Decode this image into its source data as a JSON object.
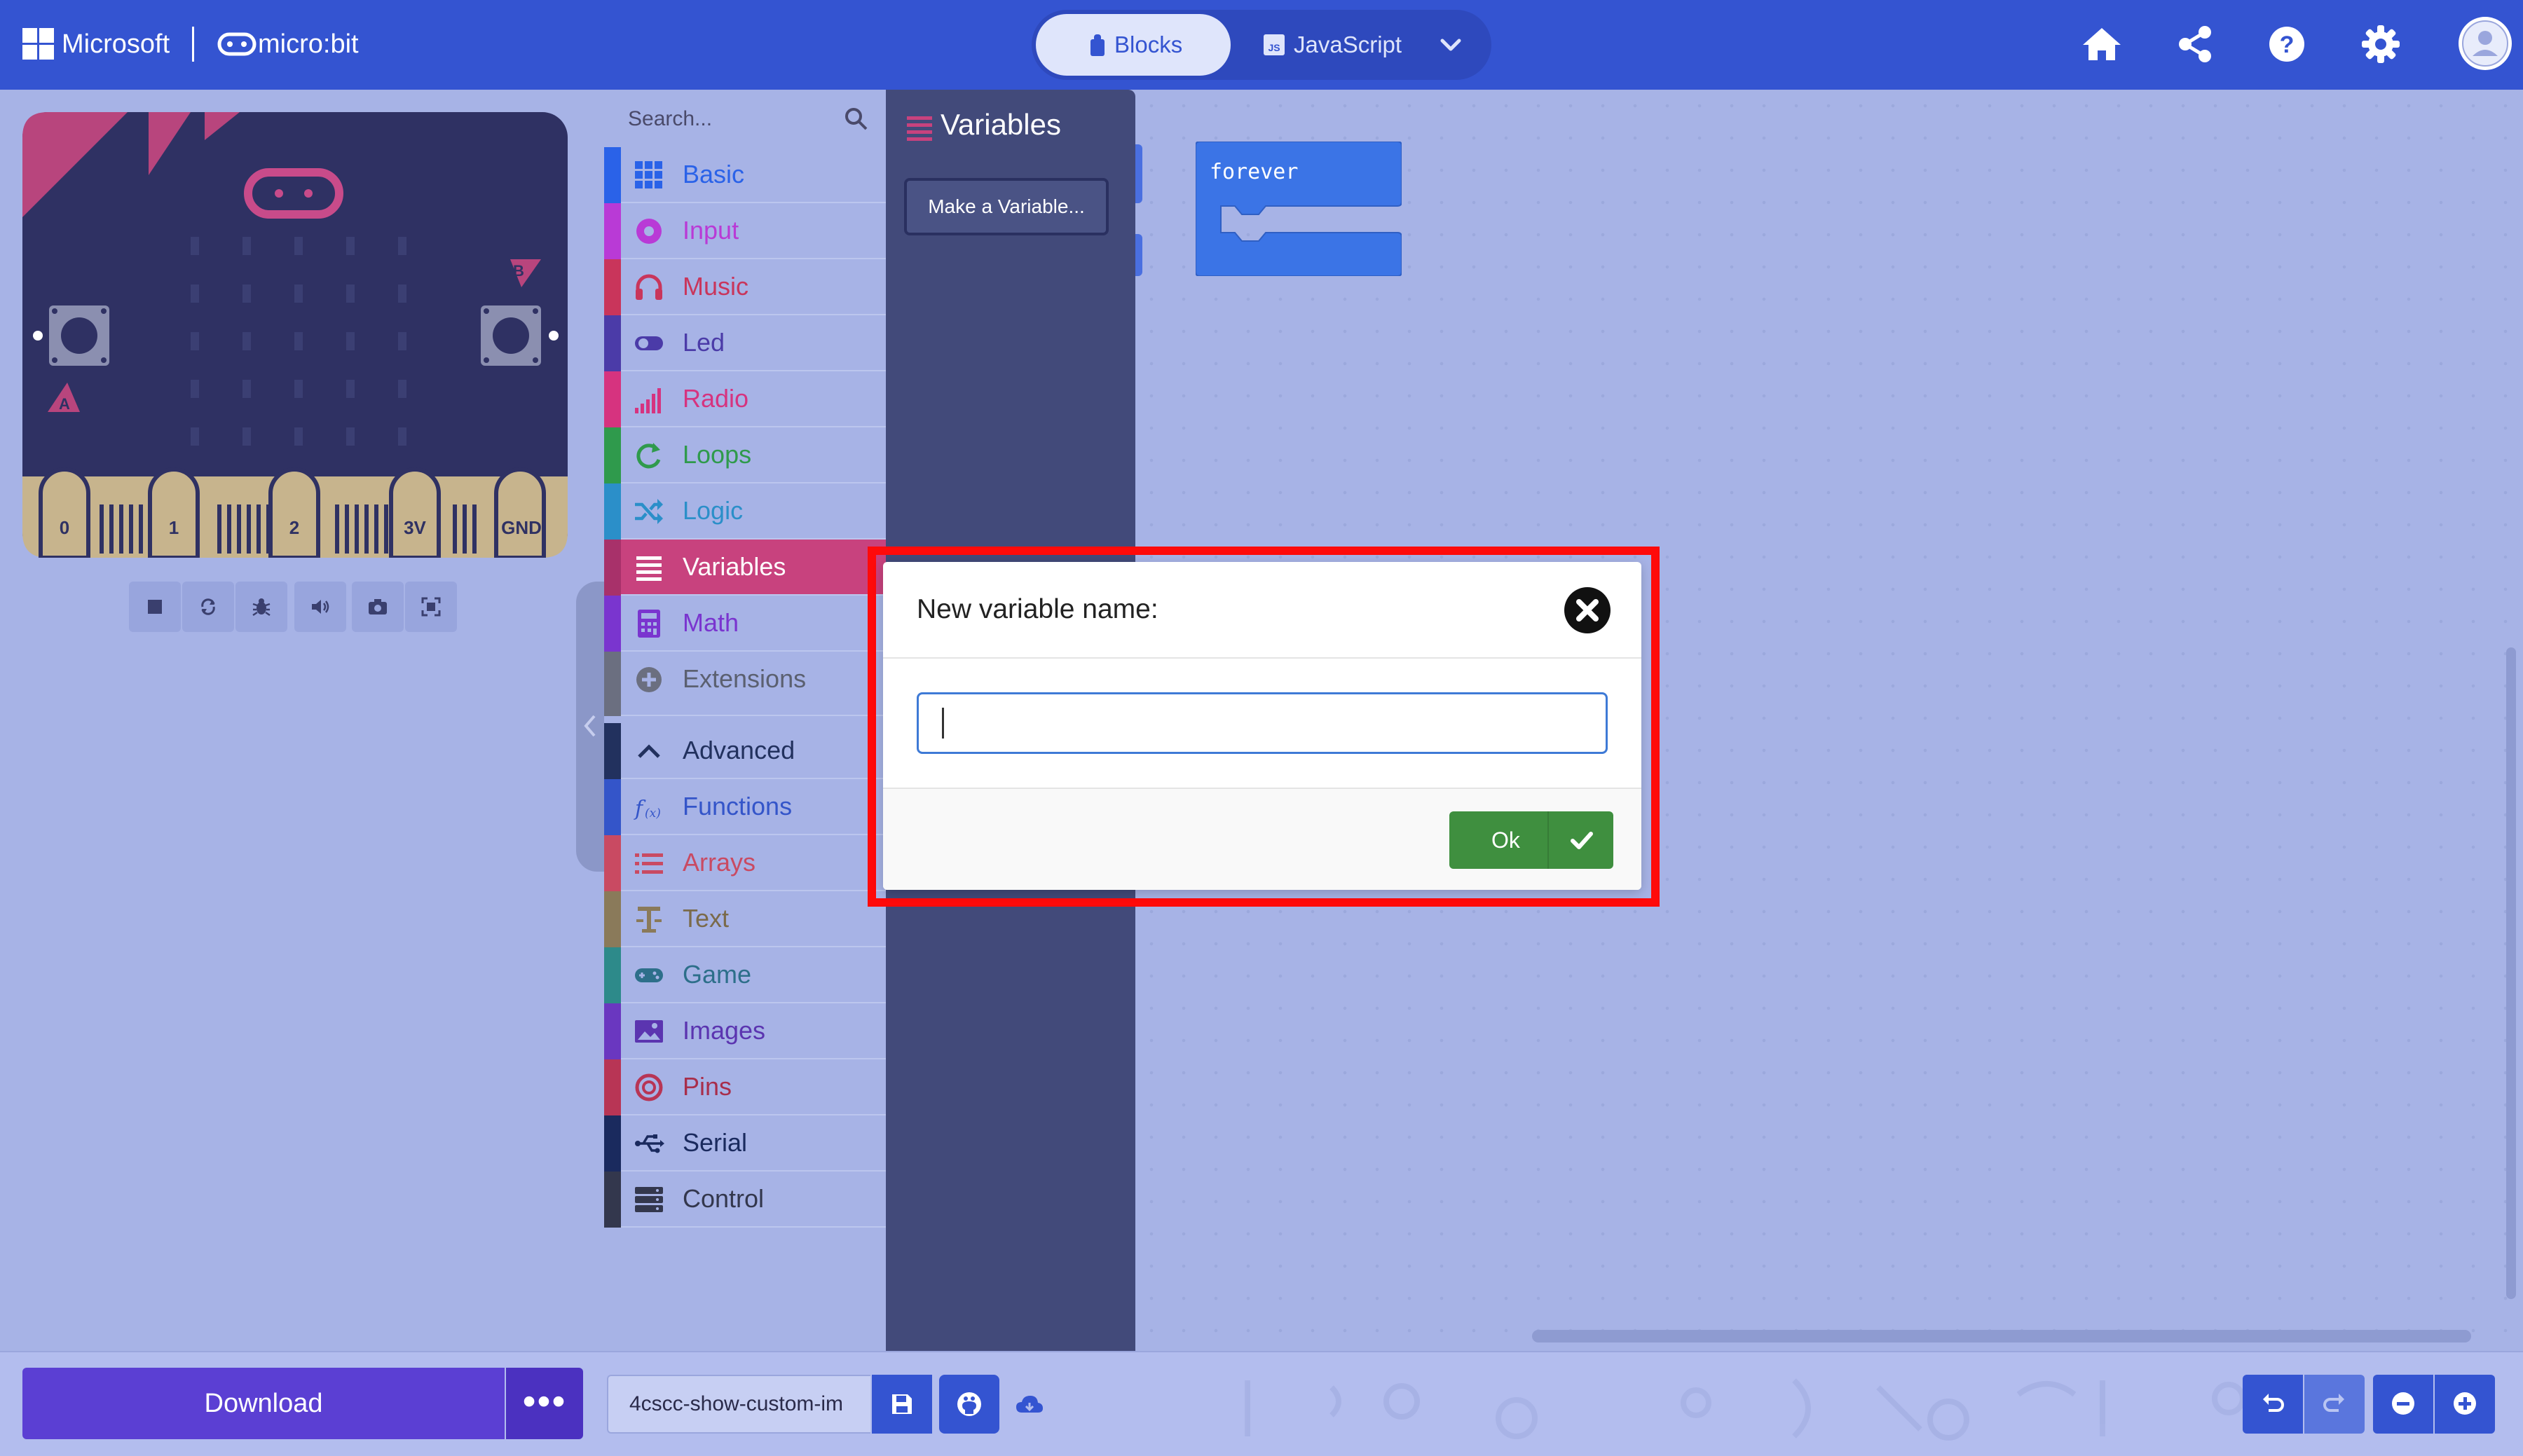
{
  "header": {
    "brand": "Microsoft",
    "product": "micro:bit",
    "mode_tabs": [
      {
        "label": "Blocks",
        "icon": "puzzle-icon",
        "active": true
      },
      {
        "label": "JavaScript",
        "icon": "js-icon",
        "active": false
      }
    ],
    "actions": [
      "home-icon",
      "share-icon",
      "help-icon",
      "settings-icon",
      "avatar"
    ]
  },
  "simulator": {
    "pins": [
      "0",
      "1",
      "2",
      "3V",
      "GND"
    ],
    "buttons": [
      "A",
      "B"
    ],
    "toolbar": [
      "stop-icon",
      "restart-icon",
      "debug-icon",
      "sound-icon",
      "screenshot-icon",
      "fullscreen-icon"
    ]
  },
  "toolbox": {
    "search_placeholder": "Search...",
    "categories": [
      {
        "label": "Basic",
        "color": "#1e90ff"
      },
      {
        "label": "Input",
        "color": "#d400d4"
      },
      {
        "label": "Music",
        "color": "#e63022"
      },
      {
        "label": "Led",
        "color": "#5c2d91"
      },
      {
        "label": "Radio",
        "color": "#e3008c"
      },
      {
        "label": "Loops",
        "color": "#00aa00"
      },
      {
        "label": "Logic",
        "color": "#00a4a6"
      },
      {
        "label": "Variables",
        "color": "#dc143c",
        "selected": true
      },
      {
        "label": "Math",
        "color": "#9400d3"
      },
      {
        "label": "Extensions",
        "color": "#707070"
      }
    ],
    "advanced_label": "Advanced",
    "advanced_categories": [
      {
        "label": "Functions",
        "color": "#3455db"
      },
      {
        "label": "Arrays",
        "color": "#e65722"
      },
      {
        "label": "Text",
        "color": "#b8860b"
      },
      {
        "label": "Game",
        "color": "#007a4b"
      },
      {
        "label": "Images",
        "color": "#7600a8"
      },
      {
        "label": "Pins",
        "color": "#b22222"
      },
      {
        "label": "Serial",
        "color": "#002050"
      },
      {
        "label": "Control",
        "color": "#333333"
      }
    ]
  },
  "flyout": {
    "title": "Variables",
    "make_variable_label": "Make a Variable..."
  },
  "workspace": {
    "blocks": [
      {
        "label": "forever",
        "color": "#1e90ff"
      }
    ]
  },
  "dialog": {
    "title": "New variable name:",
    "input_value": "",
    "ok_label": "Ok",
    "highlight_color": "#ff0000"
  },
  "bottom": {
    "download_label": "Download",
    "more_label": "•••",
    "project_name": "4cscc-show-custom-im"
  }
}
